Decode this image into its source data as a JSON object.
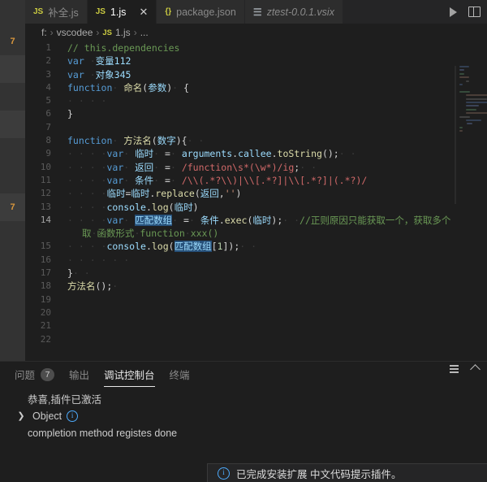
{
  "window": {
    "theme_bg": "#1e1e1e",
    "accent": "#007acc"
  },
  "activity_bar": {
    "badges": [
      {
        "label": "7"
      },
      {
        "label": "7"
      }
    ]
  },
  "tabs": [
    {
      "icon": "js-file-icon",
      "icon_text": "JS",
      "label": "补全.js",
      "active": false,
      "dirty": false,
      "italic": false,
      "closable": false
    },
    {
      "icon": "js-file-icon",
      "icon_text": "JS",
      "label": "1.js",
      "active": true,
      "dirty": false,
      "italic": false,
      "closable": true,
      "close_label": "✕"
    },
    {
      "icon": "json-file-icon",
      "icon_text": "{}",
      "label": "package.json",
      "active": false,
      "dirty": false,
      "italic": false,
      "closable": false
    },
    {
      "icon": "vsix-file-icon",
      "icon_text": "☰",
      "label": "ztest-0.0.1.vsix",
      "active": false,
      "dirty": false,
      "italic": true,
      "closable": false
    }
  ],
  "tab_actions": [
    {
      "name": "run-button",
      "glyph": "▷"
    },
    {
      "name": "split-editor-button",
      "glyph": "▣"
    }
  ],
  "breadcrumb": {
    "parts": [
      "f:",
      "vscodee",
      "1.js",
      "..."
    ],
    "file_icon_text": "JS",
    "separator": "›"
  },
  "editor": {
    "lines": [
      {
        "n": "1",
        "html": "<span class=\"cm\">// this.dependencies</span>"
      },
      {
        "n": "2",
        "html": "<span class=\"kw\">var</span> <span class=\"ws\">·</span><span class=\"id\">变量112</span>"
      },
      {
        "n": "3",
        "html": "<span class=\"kw\">var</span> <span class=\"ws\">·</span><span class=\"id\">对象345</span>"
      },
      {
        "n": "4",
        "html": "<span class=\"kw\">function</span><span class=\"ws\">·</span> <span class=\"fn\">命名</span><span class=\"pl\">(</span><span class=\"id\">参数</span><span class=\"pl\">)</span><span class=\"ws\">·</span> <span class=\"pl\">{</span>"
      },
      {
        "n": "5",
        "html": "<span class=\"ws\">· · · ·</span>"
      },
      {
        "n": "6",
        "html": "<span class=\"pl\">}</span>"
      },
      {
        "n": "7",
        "html": ""
      },
      {
        "n": "8",
        "html": "<span class=\"kw\">function</span><span class=\"ws\">·</span> <span class=\"fn\">方法名</span><span class=\"pl\">(</span><span class=\"id\">数字</span><span class=\"pl\">){</span><span class=\"ws\">· ·</span>"
      },
      {
        "n": "9",
        "html": "<span class=\"ws\">· · · ·</span><span class=\"kw\">var</span><span class=\"ws\">·</span> <span class=\"id\">临时</span><span class=\"ws\">·</span> <span class=\"pl\">=</span><span class=\"ws\">·</span> <span class=\"id\">arguments</span><span class=\"pl\">.</span><span class=\"id\">callee</span><span class=\"pl\">.</span><span class=\"fn\">toString</span><span class=\"pl\">();</span><span class=\"ws\">· ·</span>"
      },
      {
        "n": "10",
        "html": "<span class=\"ws\">· · · ·</span><span class=\"kw\">var</span><span class=\"ws\">·</span> <span class=\"id\">返回</span><span class=\"ws\">·</span> <span class=\"pl\">=</span><span class=\"ws\">·</span> <span class=\"rx\">/function\\s*(\\w*)/ig</span><span class=\"pl\">;</span><span class=\"ws\">· ·</span>"
      },
      {
        "n": "11",
        "html": "<span class=\"ws\">· · · ·</span><span class=\"kw\">var</span><span class=\"ws\">·</span> <span class=\"id\">条件</span><span class=\"ws\">·</span> <span class=\"pl\">=</span><span class=\"ws\">·</span> <span class=\"rx\">/\\\\(.*?\\\\)|\\\\[.*?]|\\\\[.*?]|(.*?)/</span>"
      },
      {
        "n": "12",
        "html": "<span class=\"ws\">· · · ·</span><span class=\"id\">临时</span><span class=\"pl\">=</span><span class=\"id\">临时</span><span class=\"pl\">.</span><span class=\"fn\">replace</span><span class=\"pl\">(</span><span class=\"id\">返回</span><span class=\"pl\">,</span><span class=\"st\">''</span><span class=\"pl\">)</span>"
      },
      {
        "n": "13",
        "html": "<span class=\"ws\">· · · ·</span><span class=\"id\">console</span><span class=\"pl\">.</span><span class=\"fn\">log</span><span class=\"pl\">(</span><span class=\"id\">临时</span><span class=\"pl\">)</span>"
      },
      {
        "n": "14",
        "html": "<span class=\"ws\">· · · ·</span><span class=\"kw\">var</span><span class=\"ws\">·</span> <span class=\"id sqh\">匹配数组</span><span class=\"ws\">·</span> <span class=\"pl\">=</span><span class=\"ws\">·</span> <span class=\"id\">条件</span><span class=\"pl\">.</span><span class=\"fn\">exec</span><span class=\"pl\">(</span><span class=\"id\">临时</span><span class=\"pl\">);</span><span class=\"ws\">· ·</span><span class=\"cm\">//正则原因只能获取一个，获取多个需借</span>"
      },
      {
        "n": "",
        "html": "<span class=\"cm\">取</span><span class=\"ws\">·</span><span class=\"cm\">函数形式</span><span class=\"ws\">·</span><span class=\"cm\">function</span><span class=\"ws\">·</span><span class=\"cm\">xxx()</span>",
        "wrap": true
      },
      {
        "n": "15",
        "html": "<span class=\"ws\">· · · ·</span><span class=\"id\">console</span><span class=\"pl\">.</span><span class=\"fn\">log</span><span class=\"pl\">(</span><span class=\"id sqh\">匹配数组</span><span class=\"pl\">[</span><span class=\"num\">1</span><span class=\"pl\">]);</span><span class=\"ws\">· ·</span>"
      },
      {
        "n": "16",
        "html": "<span class=\"ws\">· · · · · ·</span>"
      },
      {
        "n": "17",
        "html": "<span class=\"pl\">}</span><span class=\"ws\">· ·</span>"
      },
      {
        "n": "18",
        "html": "<span class=\"fn\">方法名</span><span class=\"pl\">();</span><span class=\"ws\">·</span>"
      },
      {
        "n": "19",
        "html": ""
      },
      {
        "n": "20",
        "html": ""
      },
      {
        "n": "21",
        "html": ""
      },
      {
        "n": "22",
        "html": ""
      }
    ]
  },
  "panel": {
    "tabs": [
      {
        "label": "问题",
        "badge": "7",
        "active": false
      },
      {
        "label": "输出",
        "badge": "",
        "active": false
      },
      {
        "label": "调试控制台",
        "badge": "",
        "active": true
      },
      {
        "label": "终端",
        "badge": "",
        "active": false
      }
    ],
    "actions": [
      {
        "name": "clear-console-button",
        "glyph": "≡"
      },
      {
        "name": "collapse-panel-button",
        "glyph": "^"
      }
    ],
    "console_lines": [
      {
        "text": "恭喜,插件已激活",
        "twisty": "",
        "info": false
      },
      {
        "text": "Object",
        "twisty": "❯",
        "info": true
      },
      {
        "text": "completion method registes done",
        "twisty": "",
        "info": false
      }
    ]
  },
  "toast": {
    "icon": "info-icon",
    "message": "已完成安装扩展 中文代码提示插件。"
  }
}
